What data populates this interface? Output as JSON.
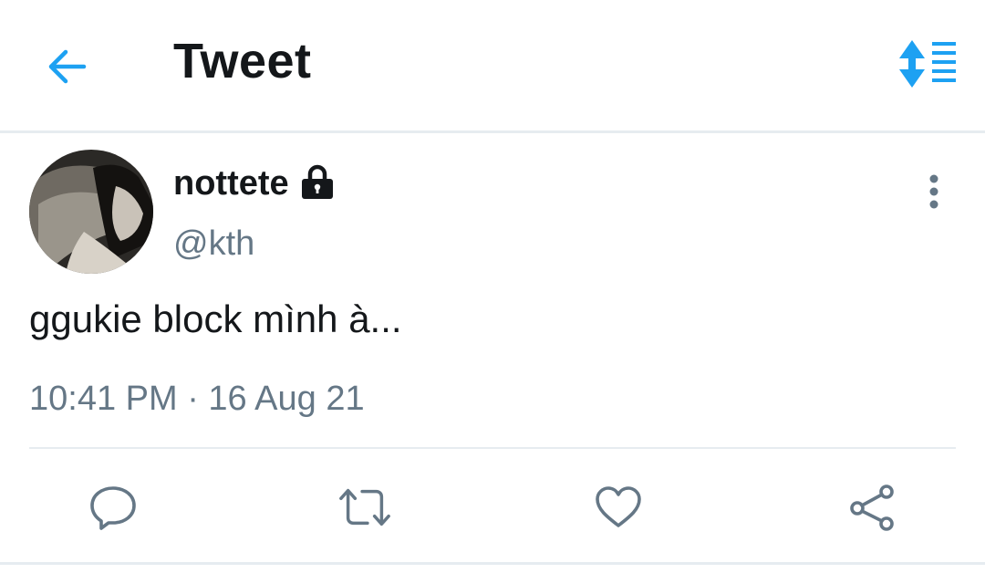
{
  "header": {
    "title": "Tweet",
    "back_icon": "arrow-left-icon",
    "sort_icon": "sort-arrows-list-icon",
    "accent_color": "#1DA1F2"
  },
  "tweet": {
    "display_name": "nottete",
    "protected_icon": "lock-icon",
    "handle": "@kth",
    "text": "ggukie block mình à...",
    "timestamp": "10:41 PM · 16 Aug 21",
    "more_icon": "more-vertical-icon"
  },
  "actions": [
    {
      "icon": "reply-icon"
    },
    {
      "icon": "retweet-icon"
    },
    {
      "icon": "like-icon"
    },
    {
      "icon": "share-icon"
    }
  ],
  "colors": {
    "text_primary": "#14171A",
    "text_secondary": "#657786",
    "divider": "#E6ECF0",
    "action_gray": "#657786"
  }
}
